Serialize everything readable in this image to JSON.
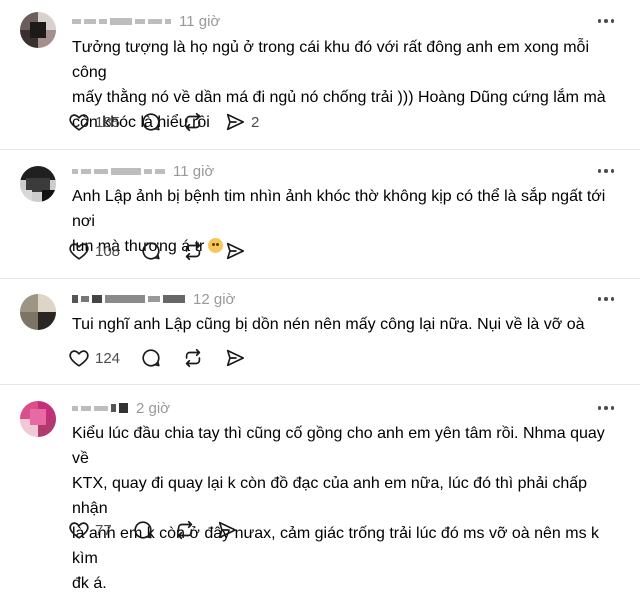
{
  "icons": {
    "like": "heart-icon",
    "reply": "comment-bubble-icon",
    "repost": "repost-icon",
    "share": "share-send-icon",
    "more": "more-dots-icon"
  },
  "posts": [
    {
      "time": "11 giờ",
      "text": "Tưởng tượng là họ ngủ ở trong cái khu đó với rất đông anh em xong mỗi công\nmấy thằng nó về dần má đi ngủ nó chống trải  ))) Hoàng Dũng cứng lắm mà\ncòn khóc là hiểu rồi",
      "likes": "185",
      "shares": "2"
    },
    {
      "time": "11 giờ",
      "text": "Anh Lập ảnh bị bệnh tim nhìn ảnh khóc thờ không kịp có thể là sắp ngất tới nơi\nlun mà thương á tr",
      "likes": "108",
      "shares": ""
    },
    {
      "time": "12 giờ",
      "text": "Tui nghĩ anh Lập cũng bị dồn nén nên mấy công lại nữa. Nụi về là vỡ oà",
      "likes": "124",
      "shares": ""
    },
    {
      "time": "2 giờ",
      "text": "Kiểu lúc đầu chia tay thì cũng cố gồng cho anh em yên tâm rồi. Nhma quay về\nKTX, quay đi quay lại k còn đồ đạc của anh em nữa, lúc đó thì phải chấp nhận\nlà anh em k còn ở đây nưax, cảm giác trống trải lúc đó ms vỡ oà nên ms k kìm\nđk á.",
      "likes": "77",
      "shares": ""
    }
  ]
}
